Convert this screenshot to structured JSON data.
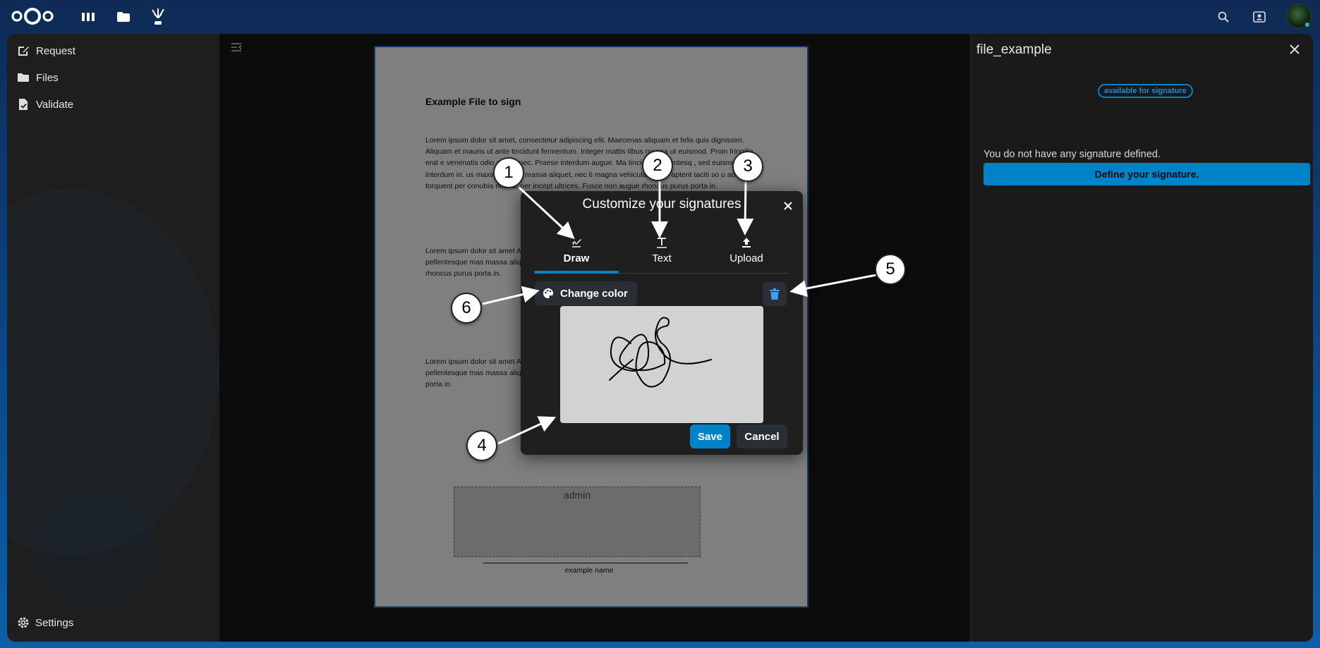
{
  "header": {
    "apps": [
      "dashboard-icon",
      "files-icon",
      "libresign-icon"
    ],
    "right_icons": [
      "search-icon",
      "contacts-icon",
      "avatar"
    ]
  },
  "nav": {
    "items": [
      {
        "label": "Request",
        "icon": "request-icon"
      },
      {
        "label": "Files",
        "icon": "folder-icon"
      },
      {
        "label": "Validate",
        "icon": "validate-icon"
      }
    ],
    "settings": "Settings"
  },
  "document": {
    "title": "Example File to sign",
    "paragraphs": [
      "Lorem ipsum dolor sit amet, consectetur adipiscing elit. Maecenas aliquam et felis quis dignissim. Aliquam et mauris ut ante tincidunt fermentum. Integer mattis tibus magna ut euismod. Proin fringilla erat e venenatis odio auctor nec. Praese interdum augue. Ma tincidunt pellentesq , sed euismod enim interdum in. us maximus mi si massa aliquet, nec ti magna vehicula. Class aptent taciti so u ad litora torquent per conubia nostra, per incept ultrices. Fusce non augue rhoncus purus porta in.",
      "Lorem ipsum dolor sit amet Aliquam et mauris ut ante Proin fringilla erat erat, nec tincidunt pellentesque mas massa aliquet, nec tincidu conubia nostra, per incept ultrices. Fusce non augue rhoncus purus porta in.",
      "Lorem ipsum dolor sit amet Aliquam et mauris ut ante Proin fringilla erat erat, nec tincidunt pellentesque mas massa aliquet, nec tincidun conubia nostra, per incept ultrices. Fusc rhoncus purus porta in."
    ],
    "sig_box_label": "admin",
    "signer_name": "example name"
  },
  "right_panel": {
    "title": "file_example",
    "badge": "available for signature",
    "message": "You do not have any signature defined.",
    "define_button": "Define your signature."
  },
  "modal": {
    "title": "Customize your signatures",
    "tabs": [
      {
        "label": "Draw",
        "icon": "draw-icon",
        "active": true
      },
      {
        "label": "Text",
        "icon": "text-icon",
        "active": false
      },
      {
        "label": "Upload",
        "icon": "upload-icon",
        "active": false
      }
    ],
    "change_color": "Change color",
    "save": "Save",
    "cancel": "Cancel"
  },
  "callouts": [
    "1",
    "2",
    "3",
    "4",
    "5",
    "6"
  ],
  "colors": {
    "primary": "#0082c9",
    "background": "#171717",
    "modal": "#1f1f1f"
  }
}
